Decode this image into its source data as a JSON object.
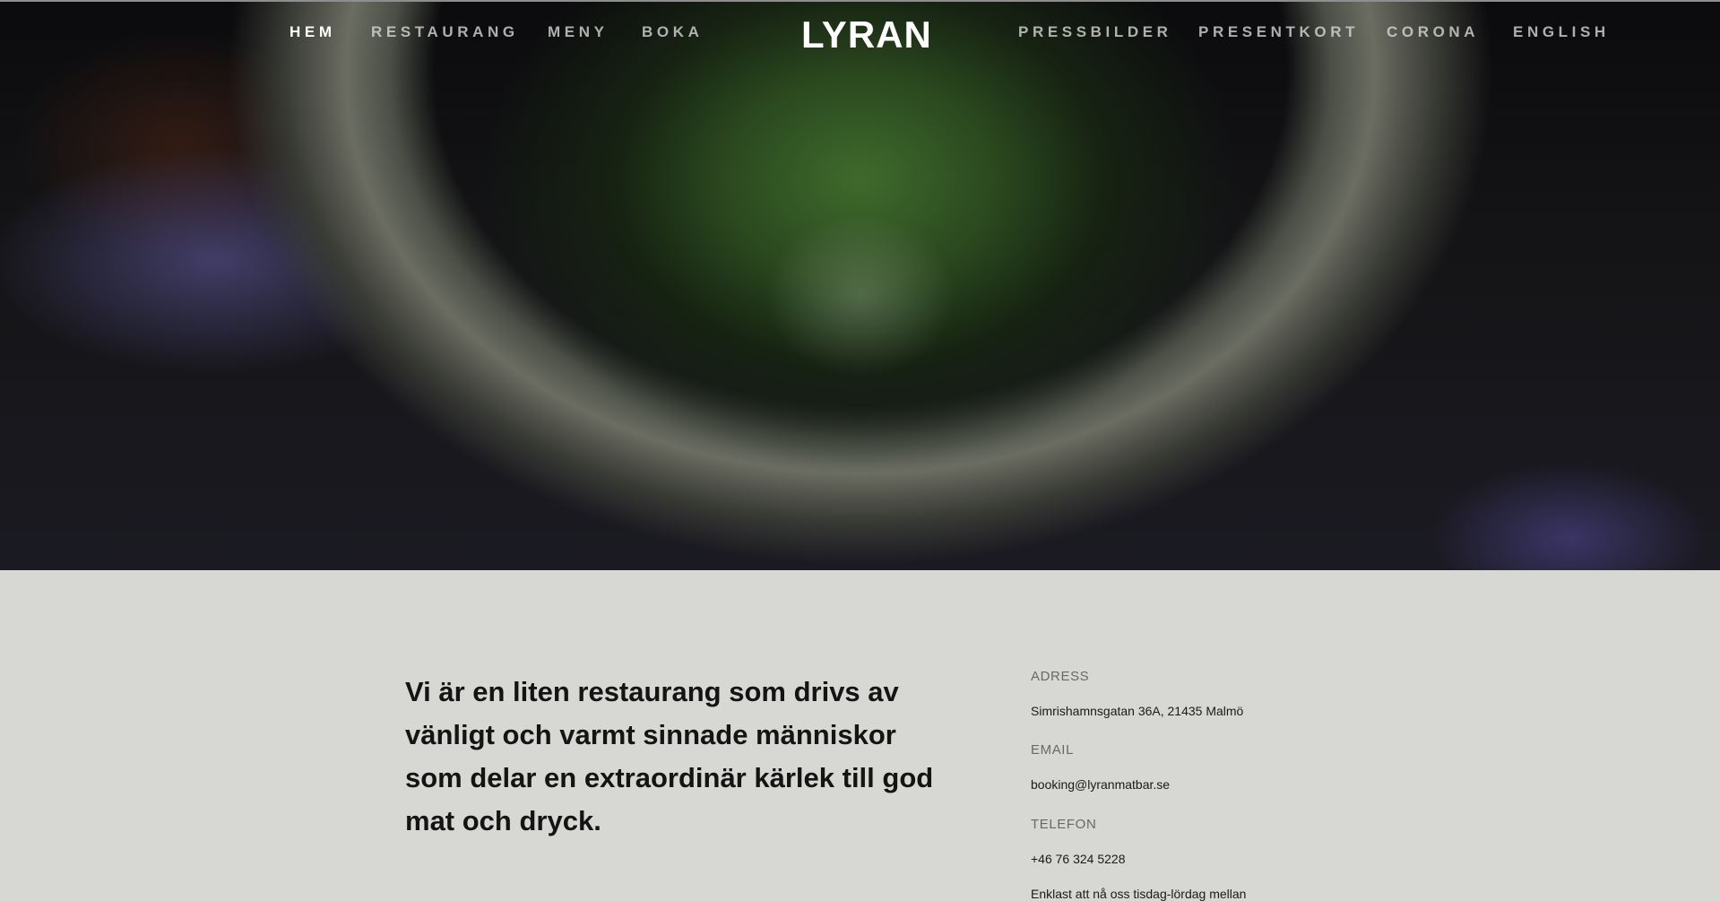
{
  "header": {
    "brand": "LYRAN",
    "nav_left": [
      "HEM",
      "RESTAURANG",
      "MENY",
      "BOKA"
    ],
    "nav_right": [
      "PRESSBILDER",
      "PRESENTKORT",
      "CORONA",
      "ENGLISH"
    ],
    "active": "HEM"
  },
  "intro": {
    "text": "Vi är en liten restaurang som drivs av vänligt och varmt sinnade människor som delar en extraordinär kärlek till god mat och dryck."
  },
  "contact": {
    "address_label": "ADRESS",
    "address": "Simrishamnsgatan 36A, 21435 Malmö",
    "email_label": "EMAIL",
    "email": "booking@lyranmatbar.se",
    "phone_label": "TELEFON",
    "phone": "+46 76 324 5228",
    "note": "Enklast att nå oss tisdag-lördag mellan"
  },
  "colors": {
    "content_bg": "#d7d8d3",
    "text_dark": "#141414",
    "label_gray": "#666a66"
  }
}
